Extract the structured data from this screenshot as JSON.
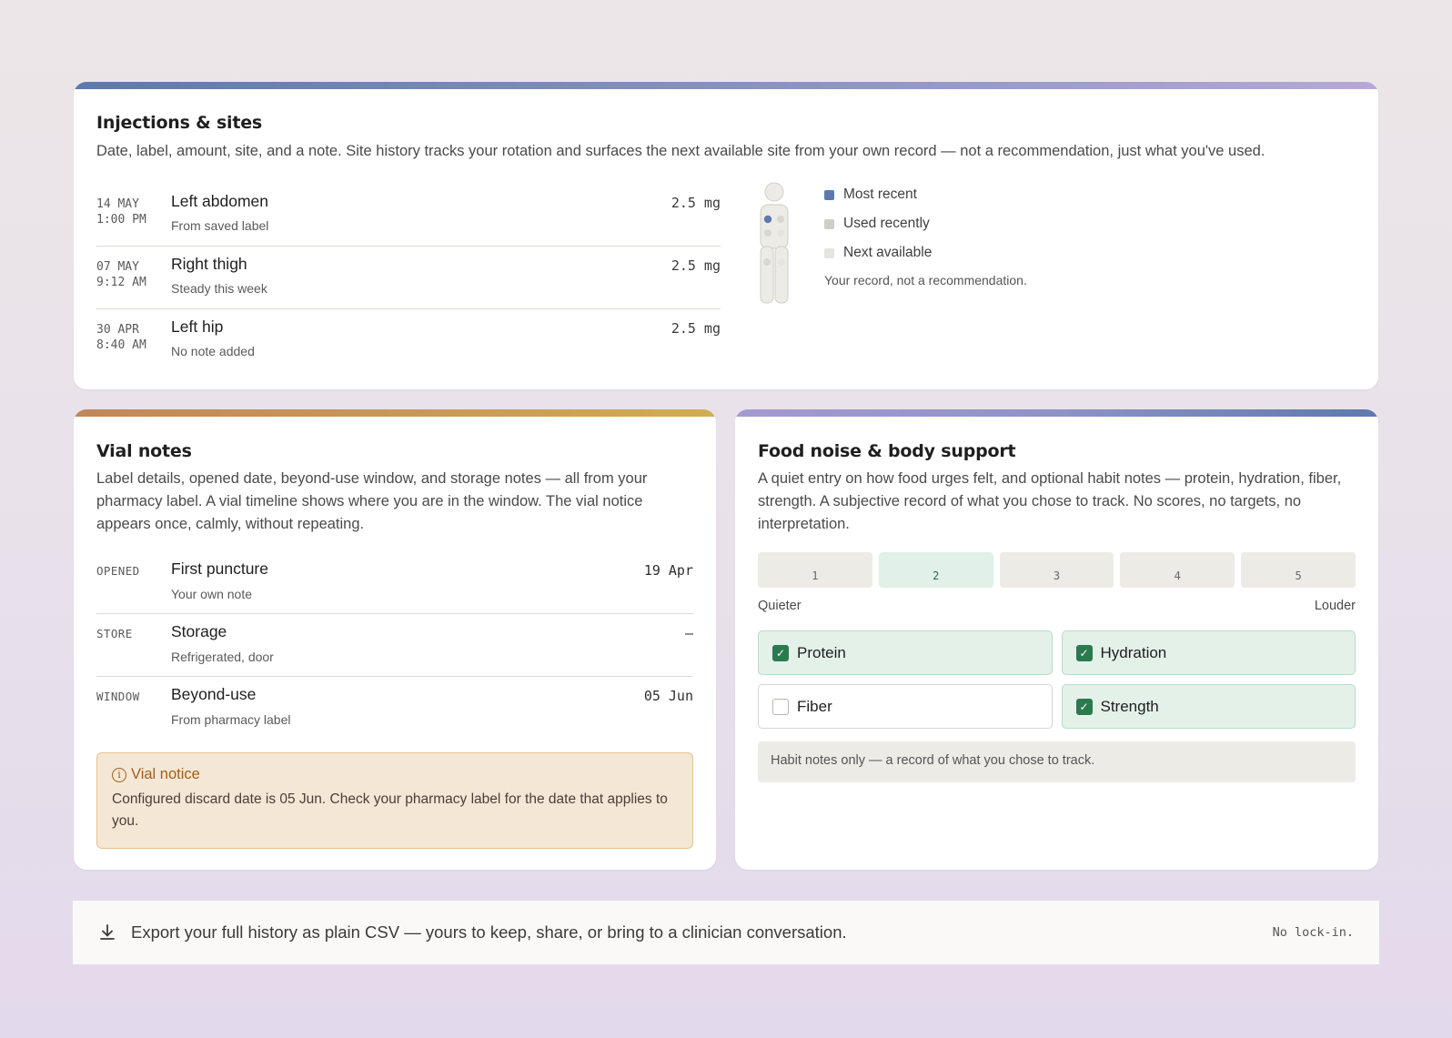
{
  "injections": {
    "title": "Injections & sites",
    "description": "Date, label, amount, site, and a note. Site history tracks your rotation and surfaces the next available site from your own record — not a recommendation, just what you've used.",
    "rows": [
      {
        "date": "14 MAY",
        "time": "1:00 PM",
        "site": "Left abdomen",
        "note": "From saved label",
        "amount": "2.5 mg"
      },
      {
        "date": "07 MAY",
        "time": "9:12 AM",
        "site": "Right thigh",
        "note": "Steady this week",
        "amount": "2.5 mg"
      },
      {
        "date": "30 APR",
        "time": "8:40 AM",
        "site": "Left hip",
        "note": "No note added",
        "amount": "2.5 mg"
      }
    ],
    "legend": [
      {
        "label": "Most recent",
        "color": "#5e79ad"
      },
      {
        "label": "Used recently",
        "color": "#cfcdc8"
      },
      {
        "label": "Next available",
        "color": "#e6e4df"
      }
    ],
    "legend_footnote": "Your record, not a recommendation."
  },
  "vial": {
    "title": "Vial notes",
    "description": "Label details, opened date, beyond-use window, and storage notes — all from your pharmacy label. A vial timeline shows where you are in the window. The vial notice appears once, calmly, without repeating.",
    "rows": [
      {
        "tag": "OPENED",
        "name": "First puncture",
        "sub": "Your own note",
        "value": "19 Apr"
      },
      {
        "tag": "STORE",
        "name": "Storage",
        "sub": "Refrigerated, door",
        "value": "—"
      },
      {
        "tag": "WINDOW",
        "name": "Beyond-use",
        "sub": "From pharmacy label",
        "value": "05 Jun"
      }
    ],
    "notice": {
      "title": "Vial notice",
      "text": "Configured discard date is 05 Jun. Check your pharmacy label for the date that applies to you."
    }
  },
  "food": {
    "title": "Food noise & body support",
    "description": "A quiet entry on how food urges felt, and optional habit notes — protein, hydration, fiber, strength. A subjective record of what you chose to track. No scores, no targets, no interpretation.",
    "scale": [
      "1",
      "2",
      "3",
      "4",
      "5"
    ],
    "scale_selected": 2,
    "scale_low": "Quieter",
    "scale_high": "Louder",
    "habits": [
      {
        "label": "Protein",
        "checked": true
      },
      {
        "label": "Hydration",
        "checked": true
      },
      {
        "label": "Fiber",
        "checked": false
      },
      {
        "label": "Strength",
        "checked": true
      }
    ],
    "habit_note": "Habit notes only — a record of what you chose to track."
  },
  "export": {
    "text": "Export your full history as plain CSV — yours to keep, share, or bring to a clinician conversation.",
    "tag": "No lock-in.",
    "icon": "download-icon"
  }
}
